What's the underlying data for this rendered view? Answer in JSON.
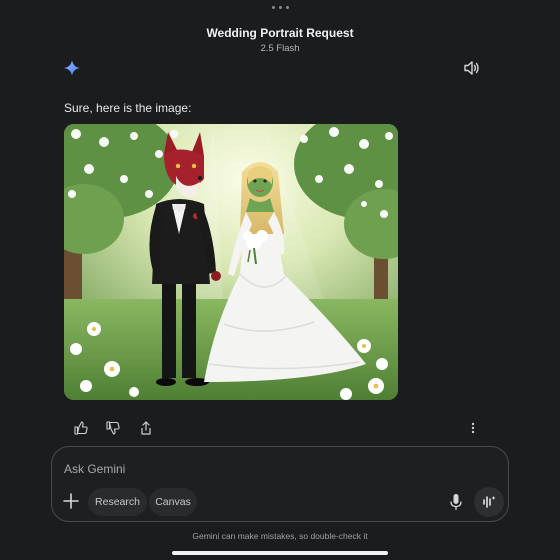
{
  "header": {
    "title": "Wedding Portrait Request",
    "model": "2.5 Flash"
  },
  "response": {
    "text": "Sure, here is the image:"
  },
  "input": {
    "placeholder": "Ask Gemini",
    "chips": [
      "Research",
      "Canvas"
    ]
  },
  "footer": {
    "disclaimer": "Gemini can make mistakes, so double-check it"
  },
  "icons": {
    "menu": "more-horizontal-dots-icon",
    "assistant": "gemini-sparkle-icon",
    "read_aloud": "speaker-icon",
    "like": "thumbs-up-icon",
    "dislike": "thumbs-down-icon",
    "share": "share-icon",
    "more": "more-vertical-icon",
    "add": "plus-icon",
    "mic": "microphone-icon",
    "live": "live-audio-icon"
  },
  "colors": {
    "background": "#1b1c1d",
    "gemini_blue": "#4c8df6",
    "input_border": "#4a4b4e"
  }
}
